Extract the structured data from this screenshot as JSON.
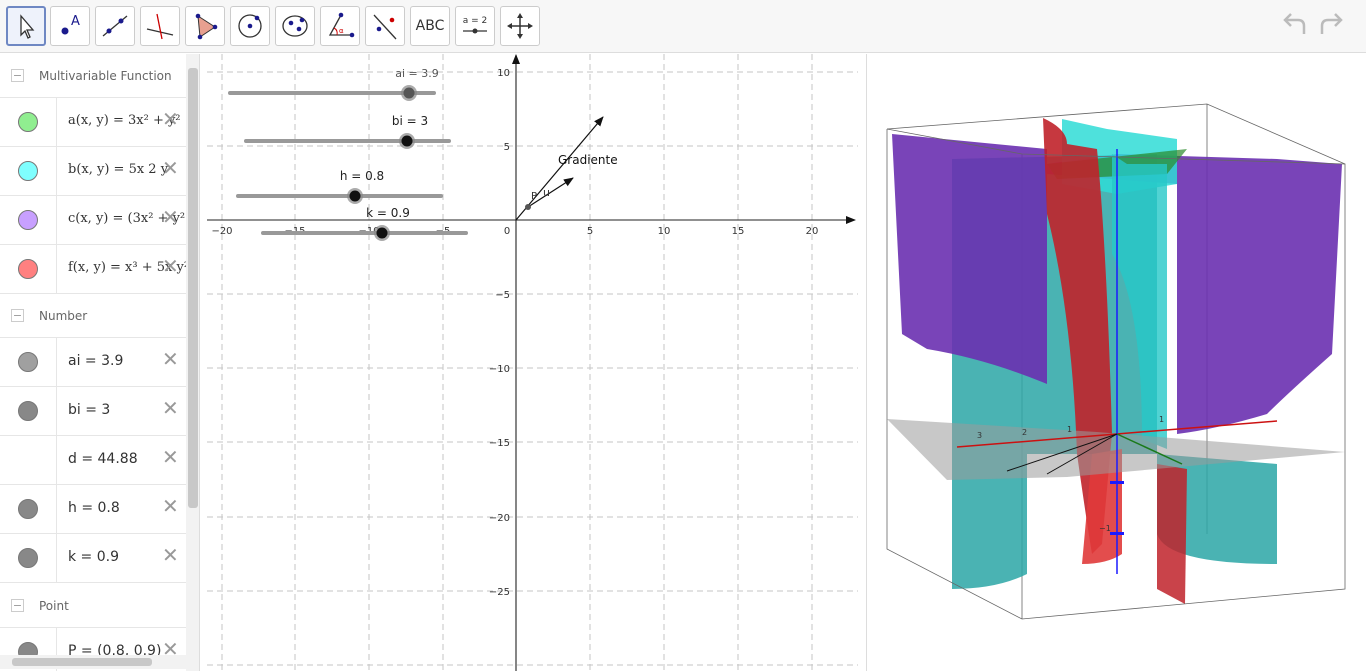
{
  "toolbar": {
    "tools": [
      {
        "name": "move-tool",
        "icon": "cursor-icon"
      },
      {
        "name": "point-tool",
        "icon": "point-icon"
      },
      {
        "name": "line-tool",
        "icon": "line-icon"
      },
      {
        "name": "perpendicular-line-tool",
        "icon": "perpendicular-icon"
      },
      {
        "name": "polygon-tool",
        "icon": "polygon-icon"
      },
      {
        "name": "circle-center-tool",
        "icon": "circle-icon"
      },
      {
        "name": "ellipse-tool",
        "icon": "ellipse-icon"
      },
      {
        "name": "angle-tool",
        "icon": "angle-icon"
      },
      {
        "name": "reflect-tool",
        "icon": "reflect-icon"
      },
      {
        "name": "text-tool",
        "icon": "text-icon",
        "label": "ABC"
      },
      {
        "name": "slider-tool",
        "icon": "slider-icon",
        "label": "a = 2"
      },
      {
        "name": "move-graphics-tool",
        "icon": "move-arrows-icon"
      }
    ],
    "undo_icon": "undo-icon",
    "redo_icon": "redo-icon"
  },
  "algebra": {
    "groups": [
      {
        "title": "Multivariable Function"
      },
      {
        "title": "Number"
      },
      {
        "title": "Point"
      }
    ],
    "functions": [
      {
        "color": "#90ee90",
        "expr": "a(x, y) = 3x² + y²"
      },
      {
        "color": "#7fffff",
        "expr": "b(x, y) = 5x 2 y"
      },
      {
        "color": "#c8a0ff",
        "expr": "c(x, y) = (3x² + y²"
      },
      {
        "color": "#ff8080",
        "expr": "f(x, y) = x³ + 5x y²"
      }
    ],
    "numbers": [
      {
        "color": "#a0a0a0",
        "expr": "ai = 3.9"
      },
      {
        "color": "#888888",
        "expr": "bi = 3"
      },
      {
        "color": "",
        "expr": "d = 44.88"
      },
      {
        "color": "#888888",
        "expr": "h = 0.8"
      },
      {
        "color": "#888888",
        "expr": "k = 0.9"
      }
    ],
    "points": [
      {
        "color": "#888888",
        "expr": "P = (0.8, 0.9)"
      }
    ]
  },
  "graphics": {
    "sliders": [
      {
        "label": "ai = 3.9"
      },
      {
        "label": "bi = 3"
      },
      {
        "label": "h = 0.8"
      },
      {
        "label": "k = 0.9"
      }
    ],
    "vector_label": "Gradiente",
    "point_label": "P",
    "vector_u_label": "u",
    "x_ticks": [
      "−20",
      "−15",
      "−10",
      "−5",
      "0",
      "5",
      "10",
      "15",
      "20"
    ],
    "y_ticks": [
      "10",
      "5",
      "−5",
      "−10",
      "−15",
      "−20",
      "−25"
    ]
  },
  "view3d": {
    "axis_labels": [
      "3",
      "2",
      "1",
      "−1",
      "1"
    ]
  }
}
